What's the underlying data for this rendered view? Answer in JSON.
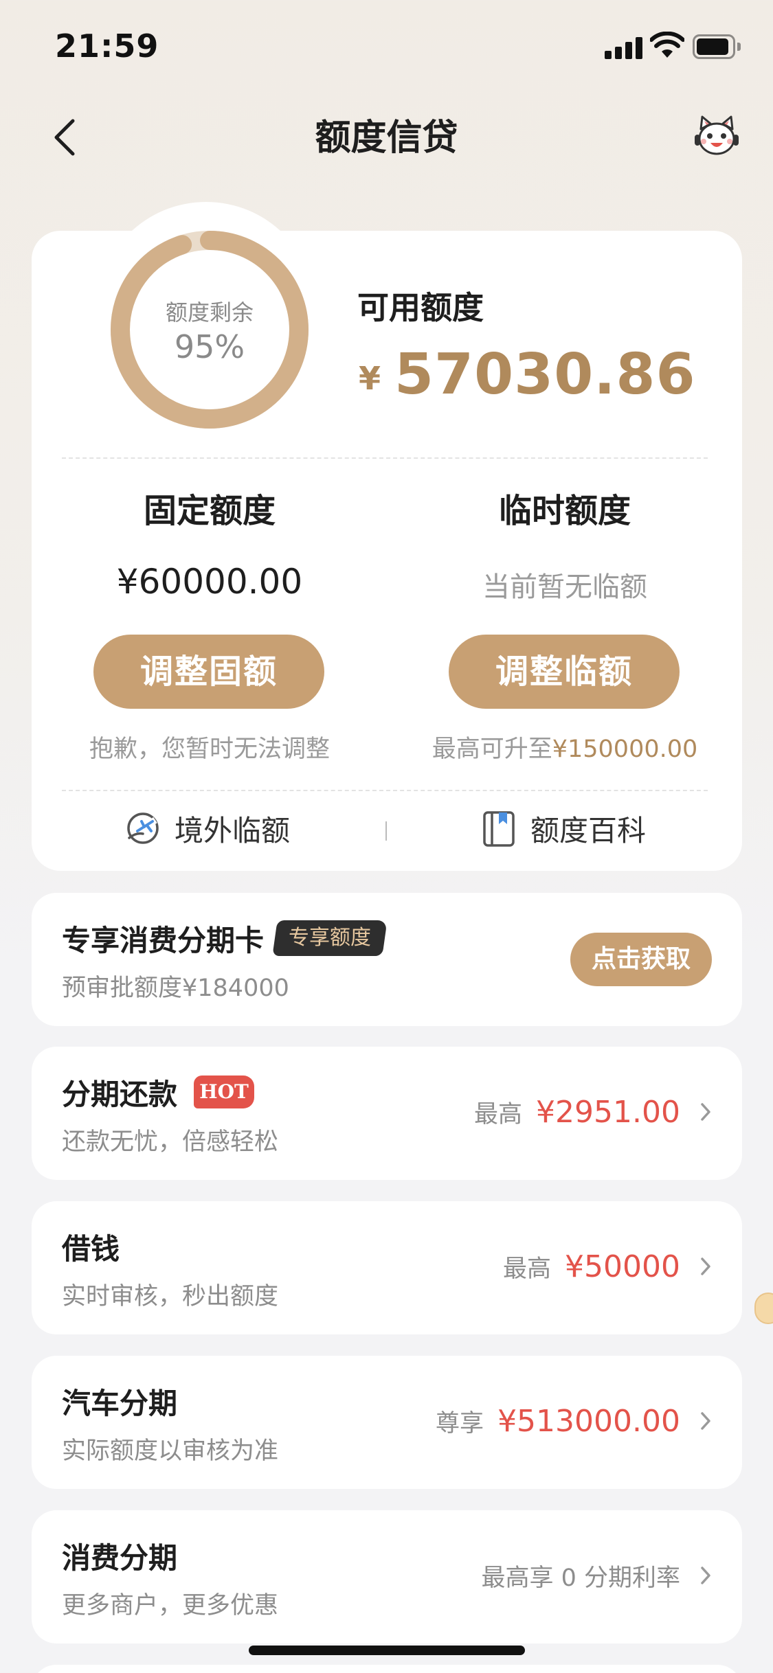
{
  "status_bar": {
    "time": "21:59"
  },
  "nav": {
    "title": "额度信贷",
    "back_icon": "chevron-left-icon",
    "service_icon": "customer-service-mascot-icon"
  },
  "credit": {
    "ring_label": "额度剩余",
    "ring_value": "95%",
    "remaining_fraction": 0.95,
    "available_label": "可用额度",
    "available_currency": "¥",
    "available_amount": "57030.86",
    "fixed": {
      "title": "固定额度",
      "amount": "¥60000.00",
      "button": "调整固额",
      "note": "抱歉，您暂时无法调整"
    },
    "temporary": {
      "title": "临时额度",
      "status": "当前暂无临额",
      "button": "调整临额",
      "note_prefix": "最高可升至",
      "note_amount": "¥150000.00"
    },
    "links": {
      "overseas": "境外临额",
      "wiki": "额度百科"
    },
    "colors": {
      "gold": "#c8a073",
      "gold_text": "#b08a5c",
      "ring_track": "#e8d4bd"
    }
  },
  "products": [
    {
      "title": "专享消费分期卡",
      "tag": "专享额度",
      "subtitle": "预审批额度¥184000",
      "button": "点击获取"
    },
    {
      "title": "分期还款",
      "badge": "HOT",
      "subtitle": "还款无忧，倍感轻松",
      "prefix": "最高",
      "amount": "¥2951.00"
    },
    {
      "title": "借钱",
      "subtitle": "实时审核，秒出额度",
      "prefix": "最高",
      "amount": "¥50000"
    },
    {
      "title": "汽车分期",
      "subtitle": "实际额度以审核为准",
      "prefix": "尊享",
      "amount": "¥513000.00"
    },
    {
      "title": "消费分期",
      "subtitle": "更多商户，更多优惠",
      "note": "最高享 0 分期利率"
    }
  ],
  "accent_red": "#e3534a"
}
